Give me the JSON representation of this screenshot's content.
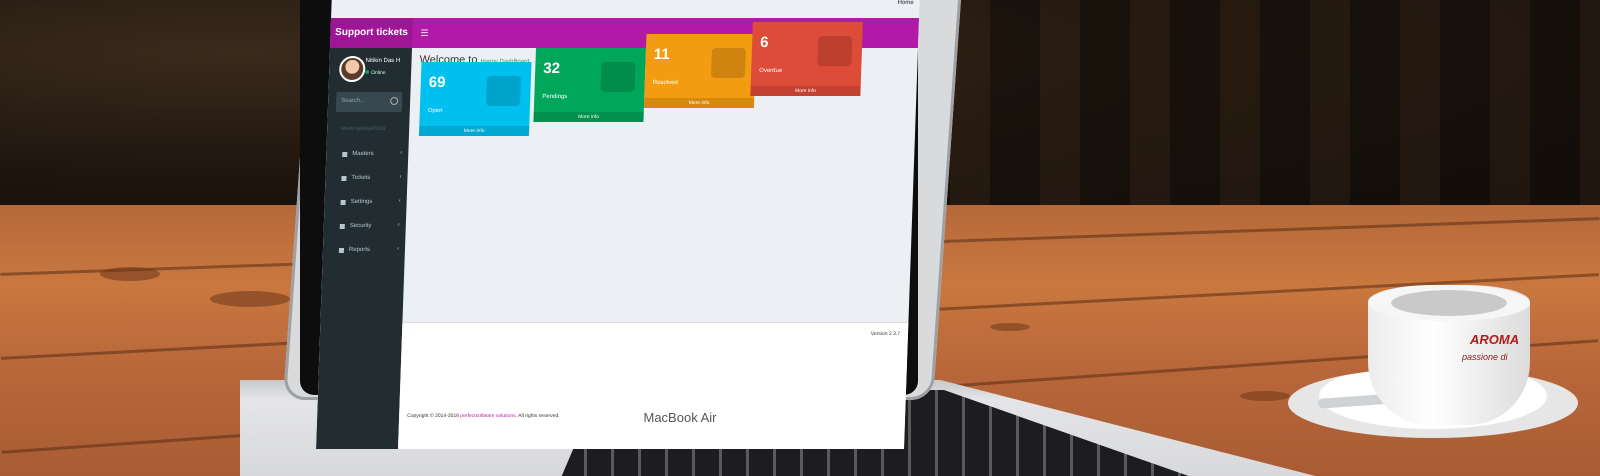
{
  "app": {
    "title": "Support tickets",
    "menu_icon": "☰",
    "home_link": "Home"
  },
  "user": {
    "name": "Nitikin Das H",
    "status": "Online"
  },
  "search": {
    "placeholder": "Search..."
  },
  "sidebar": {
    "header": "MAIN NAVIGATION",
    "items": [
      {
        "label": "Masters",
        "icon": "book-icon"
      },
      {
        "label": "Tickets",
        "icon": "list-icon"
      },
      {
        "label": "Settings",
        "icon": "wrench-icon"
      },
      {
        "label": "Security",
        "icon": "lock-icon"
      },
      {
        "label": "Reports",
        "icon": "bar-chart-icon"
      }
    ]
  },
  "dashboard": {
    "welcome": "Welcome to",
    "subtitle": "Happy DashBoard",
    "boxes": [
      {
        "count": "69",
        "label": "Open",
        "more": "More info",
        "color": "#00c0ef",
        "icon": "folder-icon"
      },
      {
        "count": "32",
        "label": "Pendings",
        "more": "More info",
        "color": "#00a65a",
        "icon": "eye-slash-icon"
      },
      {
        "count": "11",
        "label": "Resolved",
        "more": "More info",
        "color": "#f39c12",
        "icon": "thumbs-up-icon"
      },
      {
        "count": "6",
        "label": "Overdue",
        "more": "More info",
        "color": "#dd4b39",
        "icon": "fire-icon"
      }
    ]
  },
  "footer": {
    "version": "Version 2.3.7",
    "copyright_prefix": "Copyright © 2014-2016",
    "company": "perfectsoftware solutions.",
    "rights": "All rights reserved."
  },
  "device": {
    "brand": "MacBook Air"
  },
  "cup": {
    "logo": "AROMA",
    "script": "passione di"
  },
  "colors": {
    "topbar": "#b11aa6",
    "sidebar": "#222d32"
  }
}
